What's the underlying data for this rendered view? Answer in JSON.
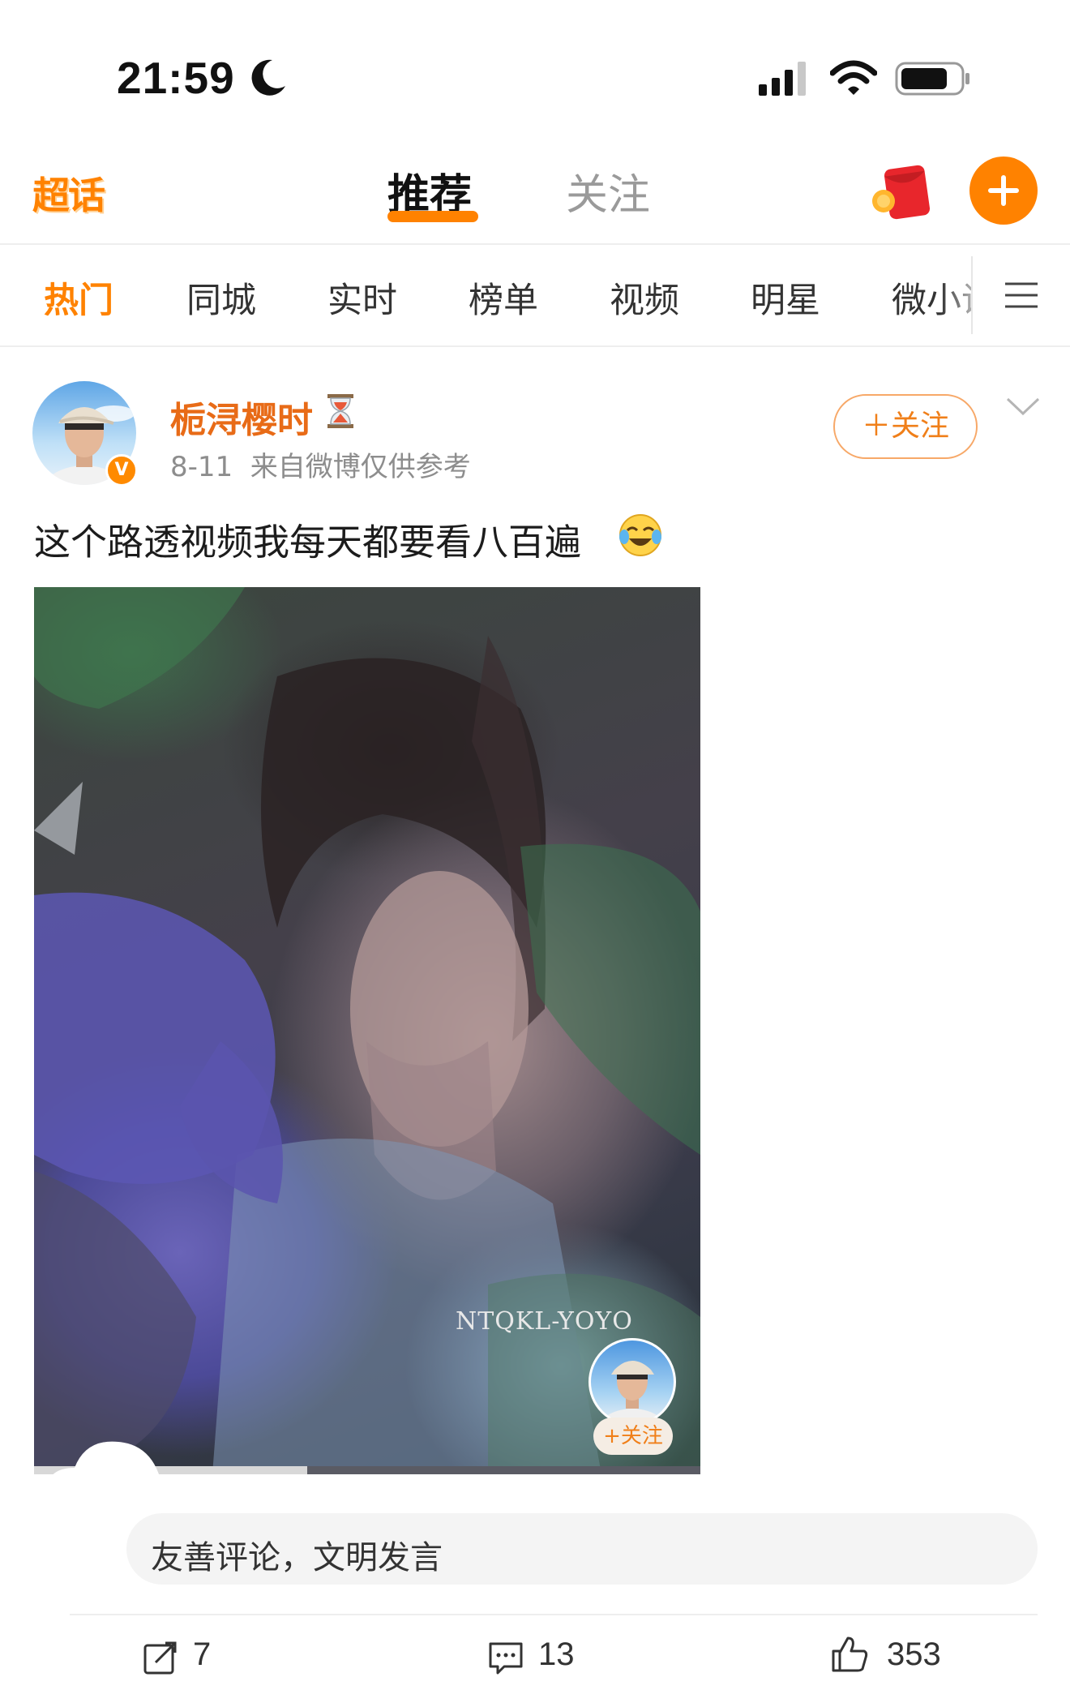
{
  "status_bar": {
    "time": "21:59"
  },
  "header": {
    "logo_text": "超话",
    "tabs": [
      {
        "label": "推荐",
        "active": true
      },
      {
        "label": "关注",
        "active": false
      }
    ],
    "accent_color": "#ff8200"
  },
  "categories": [
    {
      "label": "热门",
      "active": true
    },
    {
      "label": "同城"
    },
    {
      "label": "实时"
    },
    {
      "label": "榜单"
    },
    {
      "label": "视频"
    },
    {
      "label": "明星"
    },
    {
      "label": "微小说"
    }
  ],
  "post": {
    "username": "栀浔樱时",
    "meta": "8-11  来自微博仅供参考",
    "follow_label": "＋关注",
    "text": "这个路透视频我每天都要看八百遍",
    "video": {
      "watermark": "NTQKL-YOYO",
      "follow_label": "+关注",
      "progress": 0.41
    }
  },
  "comment": {
    "placeholder": "友善评论，文明发言"
  },
  "actions": {
    "repost": "7",
    "comments": "13",
    "likes": "353"
  }
}
